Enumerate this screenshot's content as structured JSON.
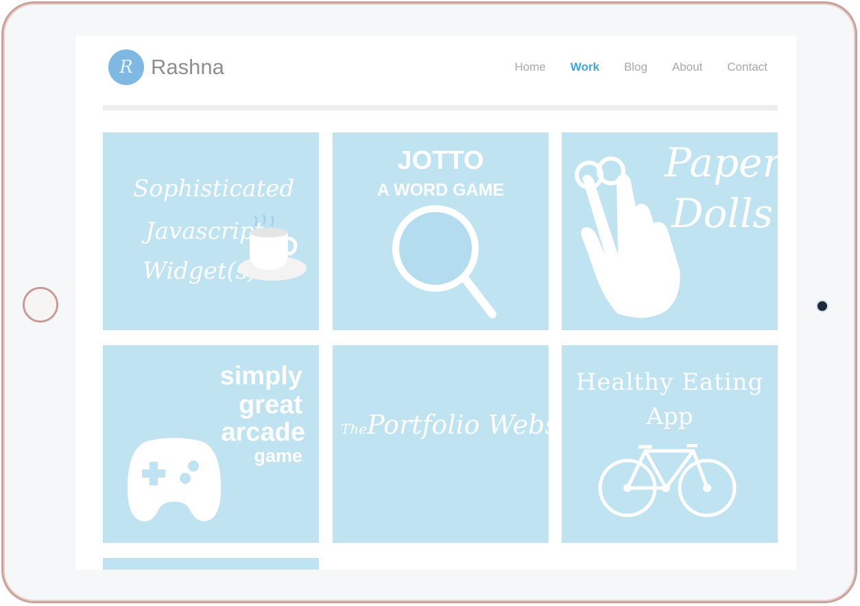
{
  "brand": {
    "name": "Rashna",
    "logo_letter": "R"
  },
  "nav": {
    "items": [
      {
        "label": "Home",
        "active": false
      },
      {
        "label": "Work",
        "active": true
      },
      {
        "label": "Blog",
        "active": false
      },
      {
        "label": "About",
        "active": false
      },
      {
        "label": "Contact",
        "active": false
      }
    ]
  },
  "tiles": {
    "widgets": {
      "line1": "Sophisticated",
      "line2": "Javascript",
      "line3": "Widget(s)"
    },
    "jotto": {
      "title": "JOTTO",
      "subtitle": "A WORD GAME"
    },
    "paperdolls": {
      "line1": "Paper",
      "line2": "Dolls"
    },
    "arcade": {
      "line1": "simply",
      "line2": "great",
      "line3": "arcade",
      "line4": "game"
    },
    "portfolio": {
      "prefix": "The",
      "title": "Portfolio Website"
    },
    "healthy": {
      "line1": "Healthy Eating",
      "line2": "App"
    }
  },
  "colors": {
    "tile": "#bfe3f1",
    "nav_active": "#3ca7d4",
    "nav": "#a7a7a7",
    "logo": "#7fb8e3",
    "device_frame": "#c9a09a"
  }
}
